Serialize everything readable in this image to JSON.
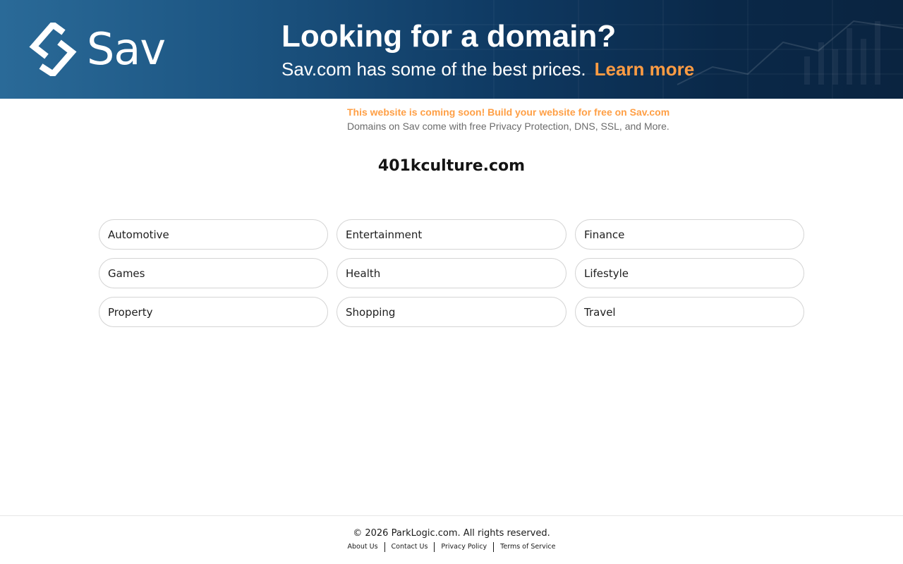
{
  "banner": {
    "logo_text": "Sav",
    "headline": "Looking for a domain?",
    "subline": "Sav.com has some of the best prices.",
    "learn_more": "Learn more",
    "colors": {
      "accent": "#ff9c43",
      "background_start": "#2a6a98",
      "background_end": "#0a2440"
    }
  },
  "promo": {
    "headline": "This website is coming soon! Build your website for free on Sav.com",
    "subline": "Domains on Sav come with free Privacy Protection, DNS, SSL, and More."
  },
  "domain": {
    "name": "401kculture.com"
  },
  "categories": [
    {
      "label": "Automotive"
    },
    {
      "label": "Entertainment"
    },
    {
      "label": "Finance"
    },
    {
      "label": "Games"
    },
    {
      "label": "Health"
    },
    {
      "label": "Lifestyle"
    },
    {
      "label": "Property"
    },
    {
      "label": "Shopping"
    },
    {
      "label": "Travel"
    }
  ],
  "footer": {
    "copyright": "© 2026 ParkLogic.com. All rights reserved.",
    "links": [
      {
        "label": "About Us"
      },
      {
        "label": "Contact Us"
      },
      {
        "label": "Privacy Policy"
      },
      {
        "label": "Terms of Service"
      }
    ]
  }
}
